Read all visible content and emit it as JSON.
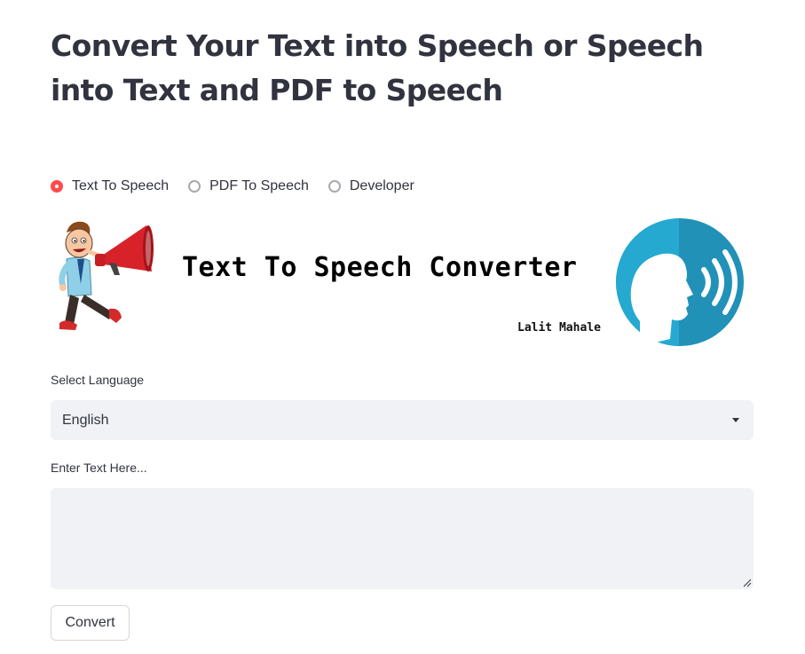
{
  "page": {
    "title": "Convert Your Text into Speech or Speech into Text and PDF to Speech"
  },
  "mode_radio": {
    "options": [
      {
        "label": "Text To Speech",
        "selected": true
      },
      {
        "label": "PDF To Speech",
        "selected": false
      },
      {
        "label": "Developer",
        "selected": false
      }
    ]
  },
  "banner": {
    "title": "Text To Speech Converter",
    "author": "Lalit Mahale"
  },
  "language": {
    "label": "Select Language",
    "selected_value": "English",
    "icon": "caret-down-icon"
  },
  "text_input": {
    "label": "Enter Text Here...",
    "value": ""
  },
  "actions": {
    "convert_label": "Convert"
  },
  "colors": {
    "accent": "#ff4b4b",
    "text": "#31333f",
    "input_bg": "#f0f2f6",
    "banner_icon_light": "#26a9d0",
    "banner_icon_dark": "#2191b8",
    "megaphone_red": "#d8222a"
  }
}
